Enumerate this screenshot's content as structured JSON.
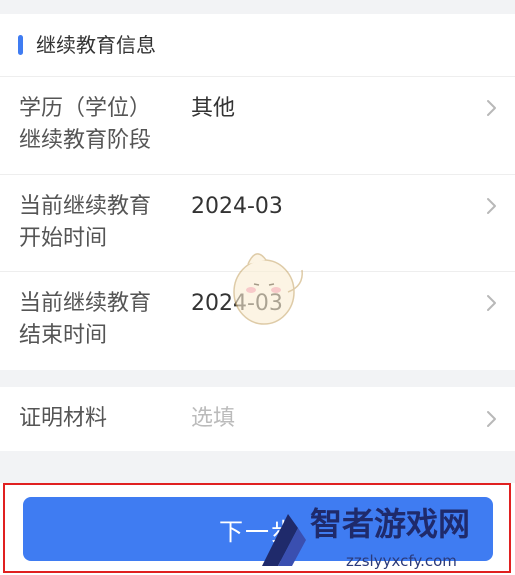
{
  "section": {
    "title": "继续教育信息"
  },
  "rows": [
    {
      "label_line1": "学历（学位）",
      "label_line2": "继续教育阶段",
      "value": "其他"
    },
    {
      "label_line1": "当前继续教育",
      "label_line2": "开始时间",
      "value": "2024-03"
    },
    {
      "label_line1": "当前继续教育",
      "label_line2": "结束时间",
      "value": "2024-03"
    }
  ],
  "proof": {
    "label": "证明材料",
    "placeholder": "选填"
  },
  "footer": {
    "next_label": "下一步"
  },
  "watermark": {
    "logo_text": "智者游戏网",
    "url": "zzslyyxcfy.com"
  },
  "icons": {
    "chevron": "chevron-right-icon"
  },
  "colors": {
    "accent": "#3f7cf2",
    "highlight": "#e02020",
    "background": "#f2f3f5"
  }
}
